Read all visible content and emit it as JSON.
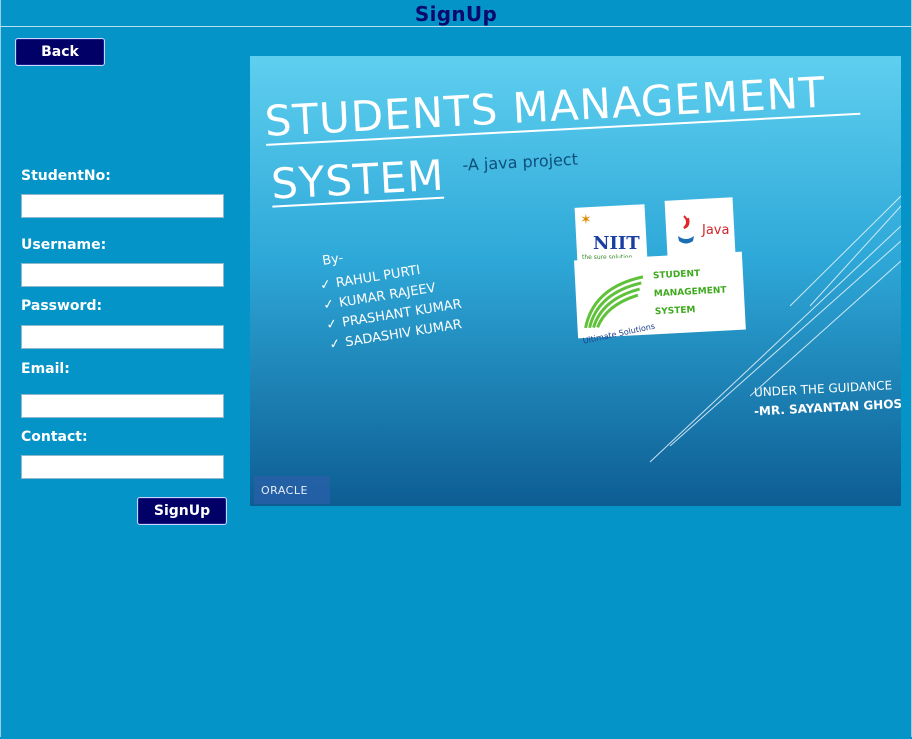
{
  "window": {
    "title": "SignUp"
  },
  "buttons": {
    "back_label": "Back",
    "signup_label": "SignUp"
  },
  "form": {
    "studentno": {
      "label": "StudentNo:",
      "value": ""
    },
    "username": {
      "label": "Username:",
      "value": ""
    },
    "password": {
      "label": "Password:",
      "value": ""
    },
    "email": {
      "label": "Email:",
      "value": ""
    },
    "contact": {
      "label": "Contact:",
      "value": ""
    }
  },
  "slide": {
    "title_line1": "STUDENTS MANAGEMENT",
    "title_line2": "SYSTEM",
    "subtitle": "-A java project",
    "by": "By-",
    "authors": [
      "RAHUL PURTI",
      "KUMAR RAJEEV",
      "PRASHANT KUMAR",
      "SADASHIV KUMAR"
    ],
    "guidance_line1": "UNDER THE GUIDANCE",
    "guidance_line2": "-MR. SAYANTAN GHOSH",
    "niit_logo": "NIIT",
    "niit_tagline": "the sure solution",
    "java_logo": "Java",
    "sms_logo_lines": [
      "STUDENT",
      "MANAGEMENT",
      "SYSTEM"
    ],
    "sms_logo_tag": "Ultimate Solutions",
    "oracle_logo": "ORACLE",
    "colors": {
      "top": "#5fcfef",
      "bottom": "#0d5d93"
    }
  }
}
